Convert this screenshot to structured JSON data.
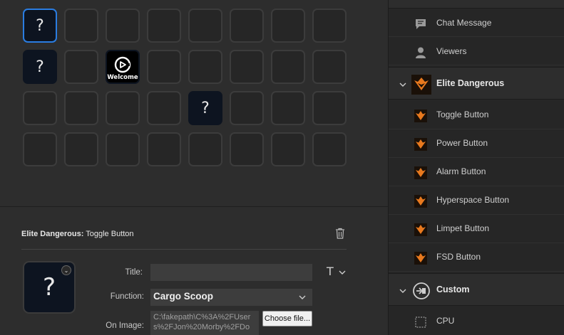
{
  "grid": {
    "welcome_label": "Welcome"
  },
  "properties": {
    "plugin_name": "Elite Dangerous:",
    "action_name": " Toggle Button",
    "title_label": "Title:",
    "title_value": "",
    "function_label": "Function:",
    "function_value": "Cargo Scoop",
    "on_image_label": "On Image:",
    "on_image_path": "C:\\fakepath\\C%3A%2FUsers%2FJon%20Morby%2FDo",
    "choose_file_label": "Choose file..."
  },
  "sidebar": {
    "twitch_items": [
      {
        "label": "Chat Message",
        "icon": "chat-icon"
      },
      {
        "label": "Viewers",
        "icon": "user-icon"
      }
    ],
    "elite_category": {
      "label": "Elite Dangerous",
      "icon": "elite-dangerous-icon"
    },
    "elite_items": [
      {
        "label": "Toggle Button"
      },
      {
        "label": "Power Button"
      },
      {
        "label": "Alarm Button"
      },
      {
        "label": "Hyperspace Button"
      },
      {
        "label": "Limpet Button"
      },
      {
        "label": "FSD Button"
      }
    ],
    "custom_category": {
      "label": "Custom",
      "icon": "custom-icon"
    },
    "custom_items": [
      {
        "label": "CPU",
        "icon": "cpu-icon"
      }
    ]
  },
  "colors": {
    "accent": "#2a7de1",
    "elite_orange": "#e8791e"
  }
}
